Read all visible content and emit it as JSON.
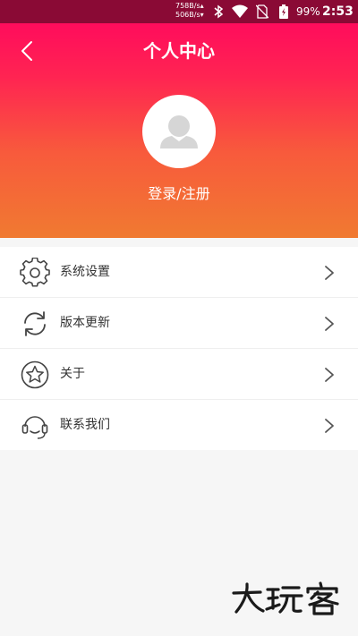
{
  "status_bar": {
    "net_speed_up": "758B/s",
    "net_speed_down": "506B/s",
    "battery": "99%",
    "time": "2:53",
    "icons": [
      "bluetooth-icon",
      "wifi-icon",
      "no-sim-icon",
      "battery-icon"
    ]
  },
  "header": {
    "title": "个人中心",
    "back_icon": "chevron-left-icon",
    "login_label": "登录/注册",
    "avatar_icon": "user-silhouette-icon"
  },
  "menu": [
    {
      "label": "系统设置",
      "icon": "gear-icon"
    },
    {
      "label": "版本更新",
      "icon": "refresh-icon"
    },
    {
      "label": "关于",
      "icon": "star-icon"
    },
    {
      "label": "联系我们",
      "icon": "headset-icon"
    }
  ],
  "colors": {
    "status_bar": "#8a0a35",
    "gradient_top": "#ff0c5c",
    "gradient_bottom": "#f07a31",
    "background": "#f6f6f6",
    "text": "#333333"
  }
}
